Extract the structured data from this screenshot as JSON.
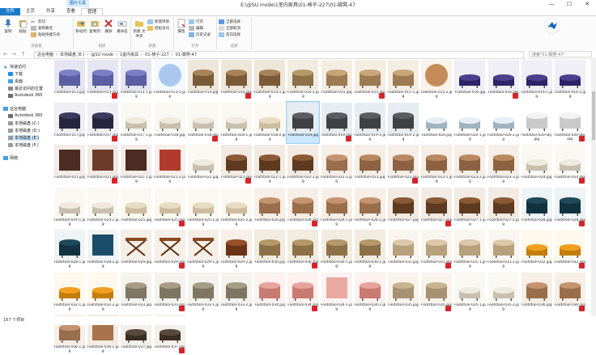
{
  "window": {
    "title": "E:\\@SU mode\\1室内家具\\01-椅子-227\\01-脚凳-47",
    "picture_tools_tab": "图片工具",
    "minimize": "—",
    "maximize": "☐",
    "close": "✕"
  },
  "tabs": [
    "文件",
    "主页",
    "共享",
    "查看",
    "管理"
  ],
  "ribbon": {
    "clipboard": {
      "label": "剪贴板",
      "pin": "固定到\n快速访问",
      "copy": "复制",
      "paste": "粘贴",
      "cut": "剪切",
      "copy_path": "复制路径",
      "paste_shortcut": "粘贴快捷方式"
    },
    "organize": {
      "label": "组织",
      "move_to": "移动到",
      "copy_to": "复制到",
      "delete": "删除",
      "rename": "重命名"
    },
    "new": {
      "label": "新建",
      "new_folder": "新建\n文件夹",
      "new_item": "新建项目",
      "easy_access": "轻松访问"
    },
    "open": {
      "label": "打开",
      "properties": "属性",
      "open": "打开",
      "edit": "编辑",
      "history": "历史记录"
    },
    "select": {
      "label": "选择",
      "select_all": "全部选择",
      "select_none": "全部取消",
      "invert": "反向选择"
    }
  },
  "nav": {
    "back": "←",
    "forward": "→",
    "up": "↑",
    "path": [
      "这台电脑",
      "本地磁盘 (E:)",
      "@SU mode",
      "1室内家具",
      "01-椅子-227",
      "01-脚凳-47"
    ],
    "search_placeholder": "搜索\"01-脚凳-47\""
  },
  "sidebar": {
    "quick_access": "快速访问",
    "items": [
      "下载",
      "桌面",
      "最近访问的位置",
      "Autodesk 360"
    ],
    "this_pc": "这台电脑",
    "pc_items": [
      "Autodesk 360",
      "本地磁盘 (C:)",
      "本地磁盘 (D:)",
      "本地磁盘 (E:)",
      "本地磁盘 (F:)"
    ],
    "network": "网络"
  },
  "files": [
    {
      "name": "Footstool-013.jpg",
      "kind": "purple-stool"
    },
    {
      "name": "Footstool-013.skp",
      "kind": "purple-stool",
      "skp": true
    },
    {
      "name": "Footstool-013-1.jpg",
      "kind": "purple-stool"
    },
    {
      "name": "Footstool-013-2.jpg",
      "kind": "disc-blue"
    },
    {
      "name": "Footstool-014.jpg",
      "kind": "wood-box"
    },
    {
      "name": "Footstool-014.skp",
      "kind": "wood-box",
      "skp": true
    },
    {
      "name": "Footstool-014-1.jpg",
      "kind": "wood-box"
    },
    {
      "name": "Footstool-014-2.jpg",
      "kind": "wicker"
    },
    {
      "name": "Footstool-015.jpg",
      "kind": "wicker-round"
    },
    {
      "name": "Footstool-015.skp",
      "kind": "wicker-round",
      "skp": true
    },
    {
      "name": "Footstool-015-1.jpg",
      "kind": "wicker-round"
    },
    {
      "name": "Footstool-015-2.jpg",
      "kind": "wicker-disc"
    },
    {
      "name": "Footstool-016.jpg",
      "kind": "purple-bench"
    },
    {
      "name": "Footstool-016.skp",
      "kind": "purple-bench",
      "skp": true
    },
    {
      "name": "Footstool-016-1.jpg",
      "kind": "purple-bench"
    },
    {
      "name": "Footstool-016-2.jpg",
      "kind": "purple-bench"
    },
    {
      "name": "Footstool-017.jpg",
      "kind": "dark-cube"
    },
    {
      "name": "Footstool-017.skp",
      "kind": "dark-cube",
      "skp": true
    },
    {
      "name": "Footstool-017-1.jpg",
      "kind": "white-bench"
    },
    {
      "name": "Footstool-018.jpg",
      "kind": "white-bench"
    },
    {
      "name": "Footstool-018.skp",
      "kind": "white-bench",
      "skp": true
    },
    {
      "name": "Footstool-018-1.jpg",
      "kind": "white-bench"
    },
    {
      "name": "Footstool-018-2.jpg",
      "kind": "cream-bench"
    },
    {
      "name": "Footstool-019.jpg",
      "kind": "grey-tufted",
      "selected": true
    },
    {
      "name": "Footstool-019.skp",
      "kind": "grey-tufted",
      "skp": true
    },
    {
      "name": "Footstool-019-1.jpg",
      "kind": "grey-tufted"
    },
    {
      "name": "Footstool-019-2.jpg",
      "kind": "grey-tufted"
    },
    {
      "name": "Footstool-020.jpg",
      "kind": "glass-table"
    },
    {
      "name": "Footstool-020-1.jpg",
      "kind": "glass-table"
    },
    {
      "name": "Footstool-020-2.jpg",
      "kind": "glass-table"
    },
    {
      "name": "Footstool-020-obj.jpg",
      "kind": "white-block"
    },
    {
      "name": "Footstool-020-obj.skp",
      "kind": "white-block",
      "skp": true
    },
    {
      "name": "Footstool-021.jpg",
      "kind": "dark-square"
    },
    {
      "name": "Footstool-021.skp",
      "kind": "brown-square",
      "skp": true
    },
    {
      "name": "Footstool-021-1.jpg",
      "kind": "dark-square"
    },
    {
      "name": "Footstool-021-2.jpg",
      "kind": "swatch"
    },
    {
      "name": "Footstool-022.jpg",
      "kind": "white-bench"
    },
    {
      "name": "Footstool-022.skp",
      "kind": "leather-brown",
      "skp": true
    },
    {
      "name": "Footstool-022-1.jpg",
      "kind": "leather-brown"
    },
    {
      "name": "Footstool-022-2.jpg",
      "kind": "leather-brown"
    },
    {
      "name": "Footstool-022-3.jpg",
      "kind": "leather-tan"
    },
    {
      "name": "Footstool-023.jpg",
      "kind": "wood-chest"
    },
    {
      "name": "Footstool-023.skp",
      "kind": "wood-chest",
      "skp": true
    },
    {
      "name": "Footstool-023-1.jpg",
      "kind": "wood-chest"
    },
    {
      "name": "Footstool-023-2.jpg",
      "kind": "wood-chest"
    },
    {
      "name": "Footstool-023-3.jpg",
      "kind": "wood-chest"
    },
    {
      "name": "Footstool-024.jpg",
      "kind": "white-bench"
    },
    {
      "name": "Footstool-024.skp",
      "kind": "white-bench",
      "skp": true
    },
    {
      "name": "Footstool-024-1.jpg",
      "kind": "white-bench"
    },
    {
      "name": "Footstool-024-2.jpg",
      "kind": "white-bench"
    },
    {
      "name": "Footstool-025.jpg",
      "kind": "cream-bench"
    },
    {
      "name": "Footstool-025.skp",
      "kind": "cream-bench",
      "skp": true
    },
    {
      "name": "Footstool-025-1.jpg",
      "kind": "cream-bench"
    },
    {
      "name": "Footstool-025-2.jpg",
      "kind": "cream-bench"
    },
    {
      "name": "Footstool-026.jpg",
      "kind": "leather-tan"
    },
    {
      "name": "Footstool-026.skp",
      "kind": "leather-tan",
      "skp": true
    },
    {
      "name": "Footstool-026-1.jpg",
      "kind": "leather-tan"
    },
    {
      "name": "Footstool-026-2.jpg",
      "kind": "leather-tan"
    },
    {
      "name": "Footstool-027.jpg",
      "kind": "leather-brown"
    },
    {
      "name": "Footstool-027.skp",
      "kind": "leather-brown",
      "skp": true
    },
    {
      "name": "Footstool-027-1.jpg",
      "kind": "leather-brown"
    },
    {
      "name": "Footstool-027-2.jpg",
      "kind": "leather-brown"
    },
    {
      "name": "Footstool-028.jpg",
      "kind": "teal-ottoman"
    },
    {
      "name": "Footstool-028.skp",
      "kind": "teal-ottoman",
      "skp": true
    },
    {
      "name": "Footstool-028-1.jpg",
      "kind": "teal-ottoman"
    },
    {
      "name": "Footstool-028-2.jpg",
      "kind": "teal-square"
    },
    {
      "name": "Footstool-029.jpg",
      "kind": "x-stool"
    },
    {
      "name": "Footstool-029.skp",
      "kind": "x-stool",
      "skp": true
    },
    {
      "name": "Footstool-029-1.jpg",
      "kind": "x-stool"
    },
    {
      "name": "Footstool-029-2.jpg",
      "kind": "wood-crate"
    },
    {
      "name": "Footstool-030.jpg",
      "kind": "wicker"
    },
    {
      "name": "Footstool-030.skp",
      "kind": "wicker",
      "skp": true
    },
    {
      "name": "Footstool-030-1.jpg",
      "kind": "wicker"
    },
    {
      "name": "Footstool-030-2.jpg",
      "kind": "wicker"
    },
    {
      "name": "Footstool-031.jpg",
      "kind": "wood-light"
    },
    {
      "name": "Footstool-031.skp",
      "kind": "wood-light",
      "skp": true
    },
    {
      "name": "Footstool-031-1.jpg",
      "kind": "wood-light"
    },
    {
      "name": "Footstool-031-2.jpg",
      "kind": "wood-light"
    },
    {
      "name": "Footstool-032.jpg",
      "kind": "orange-bench"
    },
    {
      "name": "Footstool-032.skp",
      "kind": "orange-bench",
      "skp": true
    },
    {
      "name": "Footstool-032-1.jpg",
      "kind": "orange-bench"
    },
    {
      "name": "Footstool-032-2.jpg",
      "kind": "orange-bench"
    },
    {
      "name": "Footstool-033.jpg",
      "kind": "linen-ottoman"
    },
    {
      "name": "Footstool-033.skp",
      "kind": "linen-ottoman",
      "skp": true
    },
    {
      "name": "Footstool-033-1.jpg",
      "kind": "linen-ottoman"
    },
    {
      "name": "Footstool-033-2.jpg",
      "kind": "linen-ottoman"
    },
    {
      "name": "Footstool-034.jpg",
      "kind": "pink-ottoman"
    },
    {
      "name": "Footstool-034.skp",
      "kind": "pink-ottoman",
      "skp": true
    },
    {
      "name": "Footstool-034-1.jpg",
      "kind": "pink-square"
    },
    {
      "name": "Footstool-034-2.jpg",
      "kind": "pink-ottoman"
    },
    {
      "name": "Footstool-035.jpg",
      "kind": "wicker-box"
    },
    {
      "name": "Footstool-035.skp",
      "kind": "wicker-box",
      "skp": true
    },
    {
      "name": "Footstool-035-1.jpg",
      "kind": "white-bench"
    },
    {
      "name": "Footstool-035-2.jpg",
      "kind": "white-bench"
    },
    {
      "name": "Footstool-036.jpg",
      "kind": "leather-tan"
    },
    {
      "name": "Footstool-036.skp",
      "kind": "leather-tan",
      "skp": true
    },
    {
      "name": "Footstool-036-1.jpg",
      "kind": "leather-tan"
    },
    {
      "name": "Footstool-036-2.jpg",
      "kind": "leather-texture"
    },
    {
      "name": "Footstool-037.jpg",
      "kind": "dark-table"
    },
    {
      "name": "Footstool-037.skp",
      "kind": "dark-table",
      "skp": true
    }
  ],
  "status": {
    "count": "167 个项目"
  },
  "colors": {
    "file_tab": "#1979ca",
    "selection": "#cce8ff",
    "skp_badge": "#d8232a",
    "accent": "#0a5fa8"
  }
}
